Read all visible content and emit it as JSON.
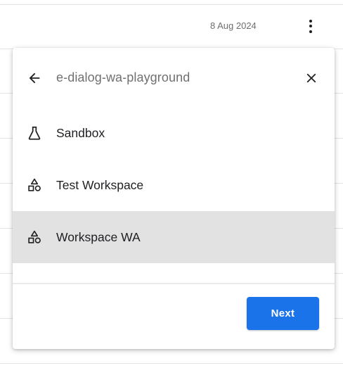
{
  "background_row": {
    "date": "8 Aug 2024",
    "menu_icon": "more-vert-icon"
  },
  "dialog": {
    "title": "e-dialog-wa-playground",
    "back_icon": "arrow-back-icon",
    "close_icon": "close-icon",
    "items": [
      {
        "label": "Sandbox",
        "icon": "beaker-icon",
        "selected": false
      },
      {
        "label": "Test Workspace",
        "icon": "category-icon",
        "selected": false
      },
      {
        "label": "Workspace WA",
        "icon": "category-icon",
        "selected": true
      }
    ],
    "next_label": "Next"
  },
  "colors": {
    "primary": "#1a73e8",
    "selected_row": "#e2e2e2",
    "muted_text": "#707070"
  }
}
